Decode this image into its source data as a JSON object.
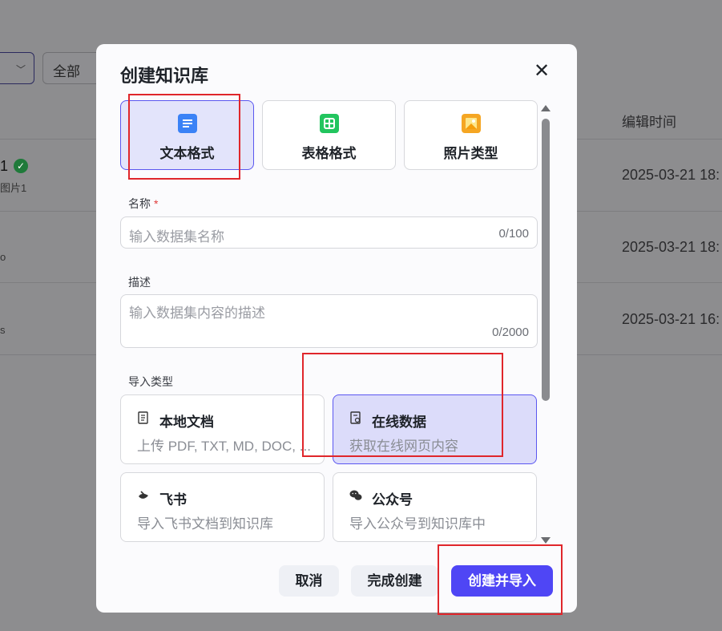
{
  "background": {
    "filter_value": "全部",
    "column_header": "编辑时间",
    "rows": [
      {
        "name": "1",
        "sub": "图片1",
        "time": "2025-03-21 18:"
      },
      {
        "name": "",
        "sub": "o",
        "time": "2025-03-21 18:"
      },
      {
        "name": "",
        "sub": "s",
        "time": "2025-03-21 16:"
      }
    ]
  },
  "modal": {
    "title": "创建知识库",
    "close_label": "✕",
    "formats": [
      {
        "label": "文本格式",
        "icon": "document-icon",
        "color": "#3b82f6",
        "active": true
      },
      {
        "label": "表格格式",
        "icon": "table-icon",
        "color": "#22c55e",
        "active": false
      },
      {
        "label": "照片类型",
        "icon": "image-icon",
        "color": "#f5a623",
        "active": false
      }
    ],
    "name_field": {
      "label": "名称",
      "required_mark": "*",
      "placeholder": "输入数据集名称",
      "count": "0/100"
    },
    "desc_field": {
      "label": "描述",
      "placeholder": "输入数据集内容的描述",
      "count": "0/2000"
    },
    "import_type_label": "导入类型",
    "import_types": [
      {
        "title": "本地文档",
        "desc": "上传 PDF, TXT, MD, DOC, ...",
        "icon": "file-icon",
        "active": false
      },
      {
        "title": "在线数据",
        "desc": "获取在线网页内容",
        "icon": "web-page-icon",
        "active": true
      },
      {
        "title": "飞书",
        "desc": "导入飞书文档到知识库",
        "icon": "feishu-icon",
        "active": false
      },
      {
        "title": "公众号",
        "desc": "导入公众号到知识库中",
        "icon": "wechat-icon",
        "active": false
      }
    ],
    "buttons": {
      "cancel": "取消",
      "finish": "完成创建",
      "create_import": "创建并导入"
    }
  }
}
